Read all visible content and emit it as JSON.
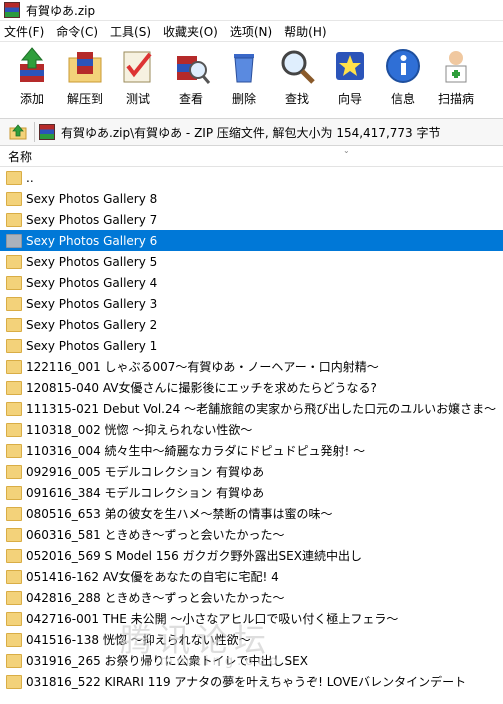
{
  "window": {
    "title": "有賀ゆあ.zip"
  },
  "menu": [
    "文件(F)",
    "命令(C)",
    "工具(S)",
    "收藏夹(O)",
    "选项(N)",
    "帮助(H)"
  ],
  "toolbar": [
    {
      "label": "添加",
      "icon": "add-archive-icon"
    },
    {
      "label": "解压到",
      "icon": "extract-to-icon"
    },
    {
      "label": "测试",
      "icon": "test-icon"
    },
    {
      "label": "查看",
      "icon": "view-icon"
    },
    {
      "label": "删除",
      "icon": "delete-icon"
    },
    {
      "label": "查找",
      "icon": "find-icon"
    },
    {
      "label": "向导",
      "icon": "wizard-icon"
    },
    {
      "label": "信息",
      "icon": "info-icon"
    },
    {
      "label": "扫描病",
      "icon": "virus-scan-icon"
    }
  ],
  "address": {
    "path": "有賀ゆあ.zip\\有賀ゆあ - ZIP 压缩文件, 解包大小为 154,417,773 字节"
  },
  "list": {
    "header": "名称",
    "items": [
      {
        "name": ".."
      },
      {
        "name": "Sexy Photos Gallery 8"
      },
      {
        "name": "Sexy Photos Gallery 7"
      },
      {
        "name": "Sexy Photos Gallery 6",
        "selected": true
      },
      {
        "name": "Sexy Photos Gallery 5"
      },
      {
        "name": "Sexy Photos Gallery 4"
      },
      {
        "name": "Sexy Photos Gallery 3"
      },
      {
        "name": "Sexy Photos Gallery 2"
      },
      {
        "name": "Sexy Photos Gallery 1"
      },
      {
        "name": "122116_001 しゃぶる007〜有賀ゆあ・ノーヘアー・口内射精〜"
      },
      {
        "name": "120815-040 AV女優さんに撮影後にエッチを求めたらどうなる?"
      },
      {
        "name": "111315-021 Debut Vol.24 〜老舗旅館の実家から飛び出した口元のユルいお嬢さま〜"
      },
      {
        "name": "110318_002 恍惚 〜抑えられない性欲〜"
      },
      {
        "name": "110316_004 続々生中〜綺麗なカラダにドピュドピュ発射! 〜"
      },
      {
        "name": "092916_005 モデルコレクション 有賀ゆあ"
      },
      {
        "name": "091616_384 モデルコレクション 有賀ゆあ"
      },
      {
        "name": "080516_653 弟の彼女を生ハメ〜禁断の情事は蜜の味〜"
      },
      {
        "name": "060316_581 ときめき〜ずっと会いたかった〜"
      },
      {
        "name": "052016_569 S Model 156 ガクガク野外露出SEX連続中出し"
      },
      {
        "name": "051416-162 AV女優をあなたの自宅に宅配! 4"
      },
      {
        "name": "042816_288 ときめき〜ずっと会いたかった〜"
      },
      {
        "name": "042716-001 THE 未公開 〜小さなアヒル口で吸い付く極上フェラ〜"
      },
      {
        "name": "041516-138 恍惚 〜抑えられない性欲〜"
      },
      {
        "name": "031916_265 お祭り帰りに公衆トイレで中出しSEX"
      },
      {
        "name": "031816_522 KIRARI 119 アナタの夢を叶えちゃうぞ! LOVEバレンタインデート"
      }
    ]
  },
  "watermark": {
    "text": "腾讯论坛",
    "subtext": "mmxing.ooo"
  }
}
